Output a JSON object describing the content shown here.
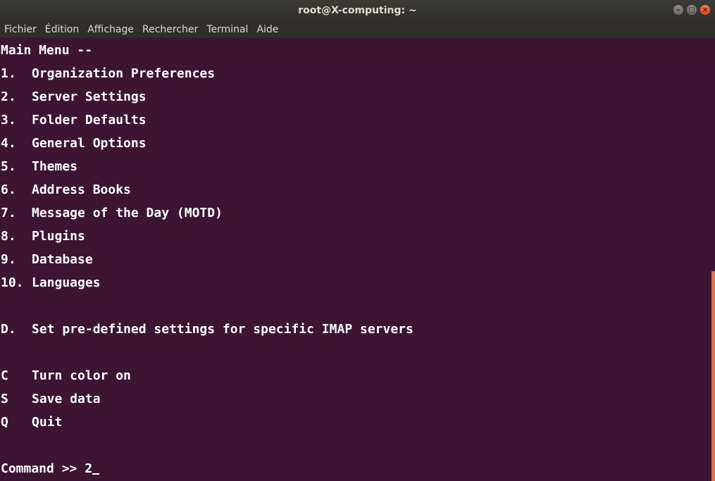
{
  "window": {
    "title": "root@X-computing: ~",
    "controls": {
      "minimize": "–",
      "maximize": "□",
      "close": "×"
    }
  },
  "menubar": [
    "Fichier",
    "Édition",
    "Affichage",
    "Rechercher",
    "Terminal",
    "Aide"
  ],
  "terminal": {
    "header": "Main Menu --",
    "items": [
      {
        "key": "1.",
        "label": "Organization Preferences"
      },
      {
        "key": "2.",
        "label": "Server Settings"
      },
      {
        "key": "3.",
        "label": "Folder Defaults"
      },
      {
        "key": "4.",
        "label": "General Options"
      },
      {
        "key": "5.",
        "label": "Themes"
      },
      {
        "key": "6.",
        "label": "Address Books"
      },
      {
        "key": "7.",
        "label": "Message of the Day (MOTD)"
      },
      {
        "key": "8.",
        "label": "Plugins"
      },
      {
        "key": "9.",
        "label": "Database"
      },
      {
        "key": "10.",
        "label": "Languages"
      }
    ],
    "special": {
      "key": "D.",
      "label": "Set pre-defined settings for specific IMAP servers"
    },
    "actions": [
      {
        "key": "C",
        "label": "Turn color on"
      },
      {
        "key": "S",
        "label": "Save data"
      },
      {
        "key": "Q",
        "label": "Quit"
      }
    ],
    "prompt": "Command >> ",
    "input_value": "2"
  },
  "colors": {
    "terminal_bg": "#3c1532",
    "text": "#ffffff",
    "scrollbar": "#e0704a"
  }
}
